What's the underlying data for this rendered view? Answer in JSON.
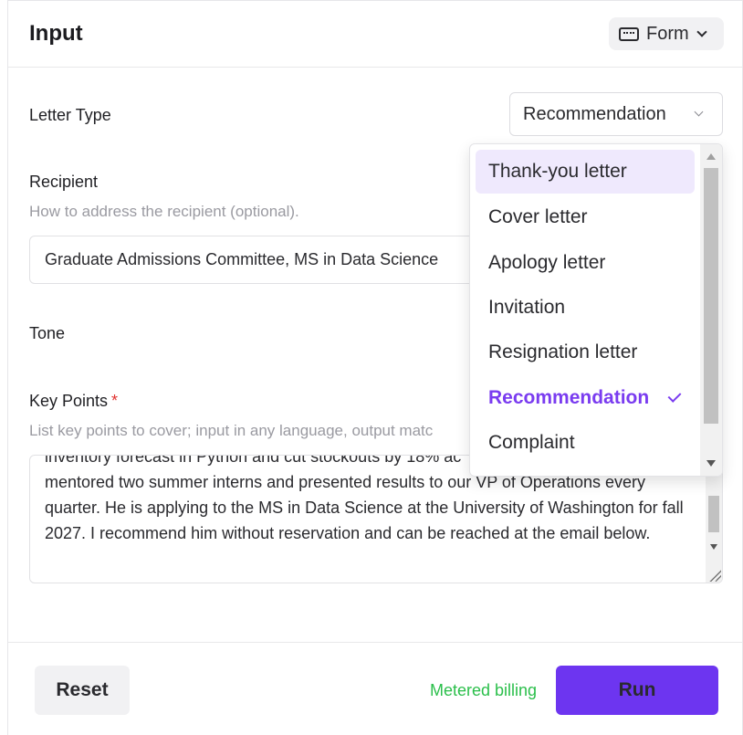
{
  "header": {
    "title": "Input",
    "mode_label": "Form"
  },
  "form": {
    "letter_type": {
      "label": "Letter Type",
      "value": "Recommendation"
    },
    "recipient": {
      "label": "Recipient",
      "hint": "How to address the recipient (optional).",
      "value": "Graduate Admissions Committee, MS in Data Science"
    },
    "tone": {
      "label": "Tone"
    },
    "key_points": {
      "label": "Key Points",
      "required_mark": "*",
      "hint": "List key points to cover; input in any language, output matc",
      "value": "inventory forecast in Python and cut stockouts by 18% ac\nmentored two summer interns and presented results to our VP of Operations every quarter. He is applying to the MS in Data Science at the University of Washington for fall 2027. I recommend him without reservation and can be reached at the email below."
    }
  },
  "dropdown": {
    "options": [
      "Thank-you letter",
      "Cover letter",
      "Apology letter",
      "Invitation",
      "Resignation letter",
      "Recommendation",
      "Complaint"
    ],
    "highlighted_index": 0,
    "selected_index": 5
  },
  "footer": {
    "reset_label": "Reset",
    "billing_text": "Metered billing",
    "run_label": "Run"
  },
  "colors": {
    "accent": "#6d35f0",
    "selected_text": "#7a3cf0",
    "billing_green": "#2bbf4b",
    "required_red": "#e0322f"
  }
}
